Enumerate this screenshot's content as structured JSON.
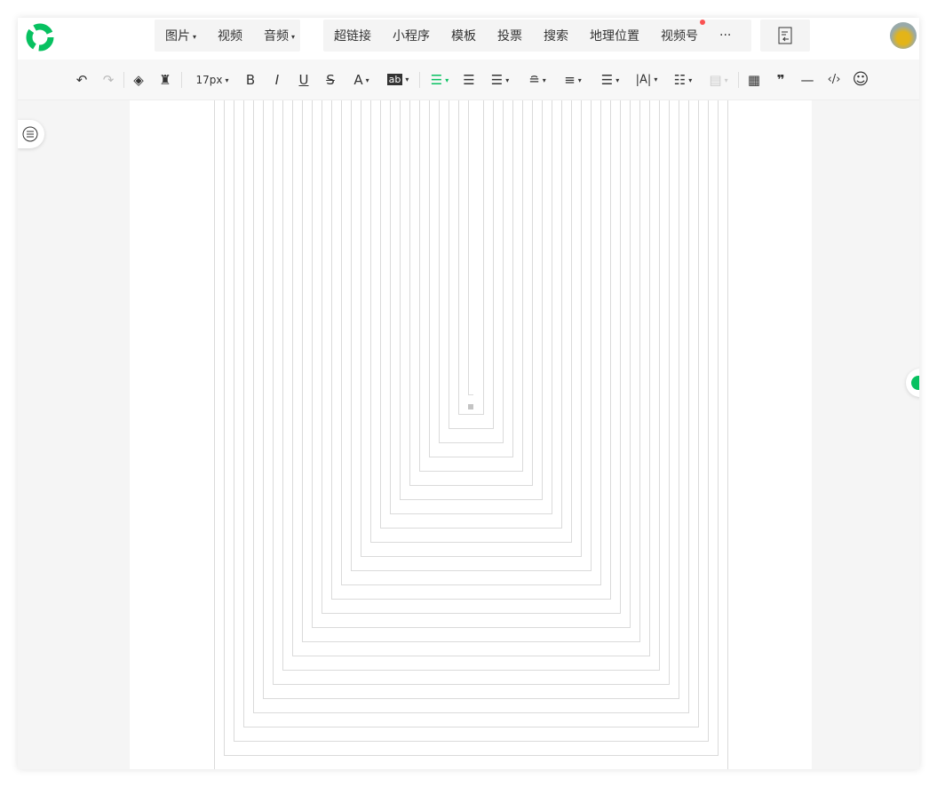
{
  "nav": {
    "group1": [
      {
        "label": "图片",
        "dd": true
      },
      {
        "label": "视频",
        "dd": false
      },
      {
        "label": "音频",
        "dd": true
      }
    ],
    "group2": [
      {
        "label": "超链接"
      },
      {
        "label": "小程序"
      },
      {
        "label": "模板"
      },
      {
        "label": "投票"
      },
      {
        "label": "搜索"
      },
      {
        "label": "地理位置"
      },
      {
        "label": "视频号",
        "badge": true
      },
      {
        "label": "···"
      }
    ]
  },
  "toolbar": {
    "undo": "↶",
    "redo": "↷",
    "font_size": "17px",
    "bold": "B",
    "italic": "I",
    "underline": "U",
    "strike": "S",
    "font_color": "A",
    "bg_color": "ab",
    "letter_spacing": "|A|",
    "quote": "❞",
    "hr": "—",
    "code": "‹/›",
    "emoji": "☺",
    "table": "▦"
  },
  "colors": {
    "brand": "#07c160",
    "badge": "#fa5151"
  },
  "nesting_depth": 26
}
